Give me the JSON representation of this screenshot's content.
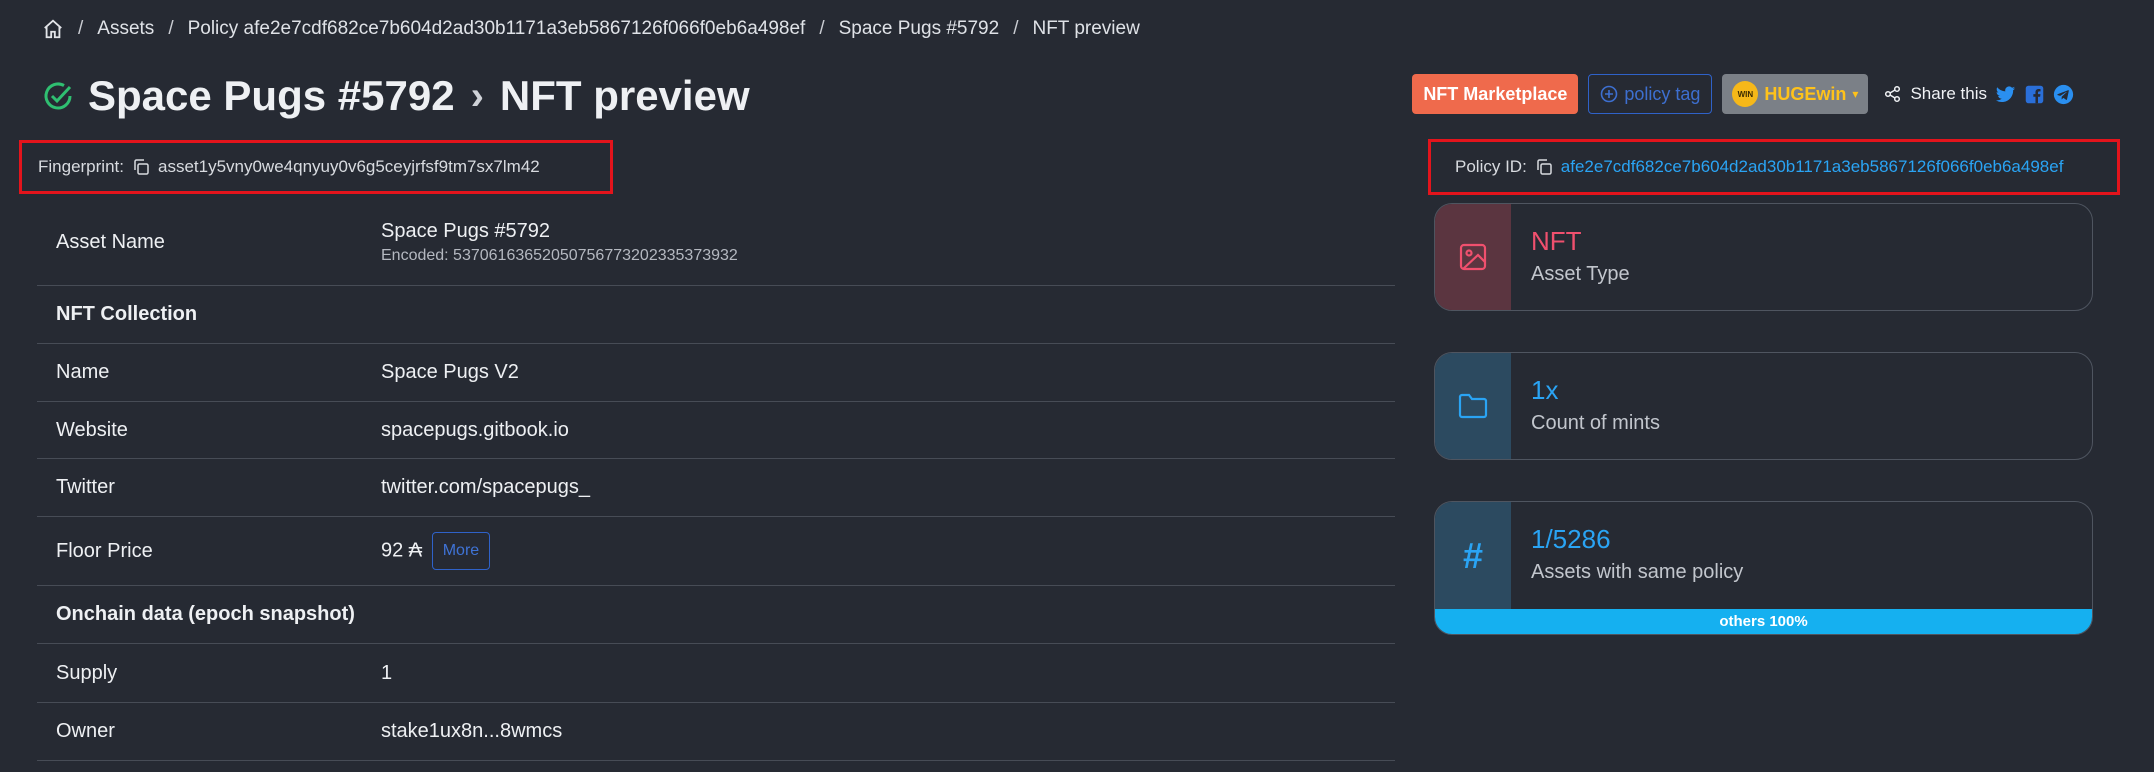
{
  "breadcrumb": {
    "items": [
      "Assets",
      "Policy afe2e7cdf682ce7b604d2ad30b1171a3eb5867126f066f0eb6a498ef",
      "Space Pugs #5792",
      "NFT preview"
    ],
    "separator": "/"
  },
  "title": {
    "asset": "Space Pugs #5792",
    "chevron": "›",
    "page": "NFT preview"
  },
  "actions": {
    "marketplace_label": "NFT Marketplace",
    "policy_tag_label": "policy tag",
    "huge_label": "HUGEwin",
    "huge_caret": "▾",
    "huge_logo_text": "WIN",
    "share_label": "Share this"
  },
  "fingerprint": {
    "label": "Fingerprint:",
    "value": "asset1y5vny0we4qnyuy0v6g5ceyjrfsf9tm7sx7lm42"
  },
  "policy": {
    "label": "Policy ID:",
    "value": "afe2e7cdf682ce7b604d2ad30b1171a3eb5867126f066f0eb6a498ef"
  },
  "table": {
    "asset_name": {
      "key": "Asset Name",
      "value": "Space Pugs #5792",
      "encoded": "Encoded: 537061636520507567732023353739​32"
    },
    "nft_collection": "NFT Collection",
    "name": {
      "key": "Name",
      "value": "Space Pugs V2"
    },
    "website": {
      "key": "Website",
      "value": "spacepugs.gitbook.io"
    },
    "twitter": {
      "key": "Twitter",
      "value": "twitter.com/spacepugs_"
    },
    "floor_price": {
      "key": "Floor Price",
      "value": "92 ₳",
      "more": "More"
    },
    "onchain": "Onchain data (epoch snapshot)",
    "supply": {
      "key": "Supply",
      "value": "1"
    },
    "owner": {
      "key": "Owner",
      "value": "stake1ux8n...8wmcs"
    }
  },
  "cards": {
    "type": {
      "value": "NFT",
      "label": "Asset Type"
    },
    "mints": {
      "value": "1x",
      "label": "Count of mints"
    },
    "policy_assets": {
      "value": "1/5286",
      "label": "Assets with same policy",
      "icon_glyph": "#",
      "progress_label": "others 100%",
      "progress_fraction": 1.0
    }
  },
  "colors": {
    "background": "#262a33",
    "link": "#2aa4f4",
    "marketplace": "#ef6a4c",
    "highlight_box": "#e3141c",
    "nft_accent": "#f0506e"
  }
}
